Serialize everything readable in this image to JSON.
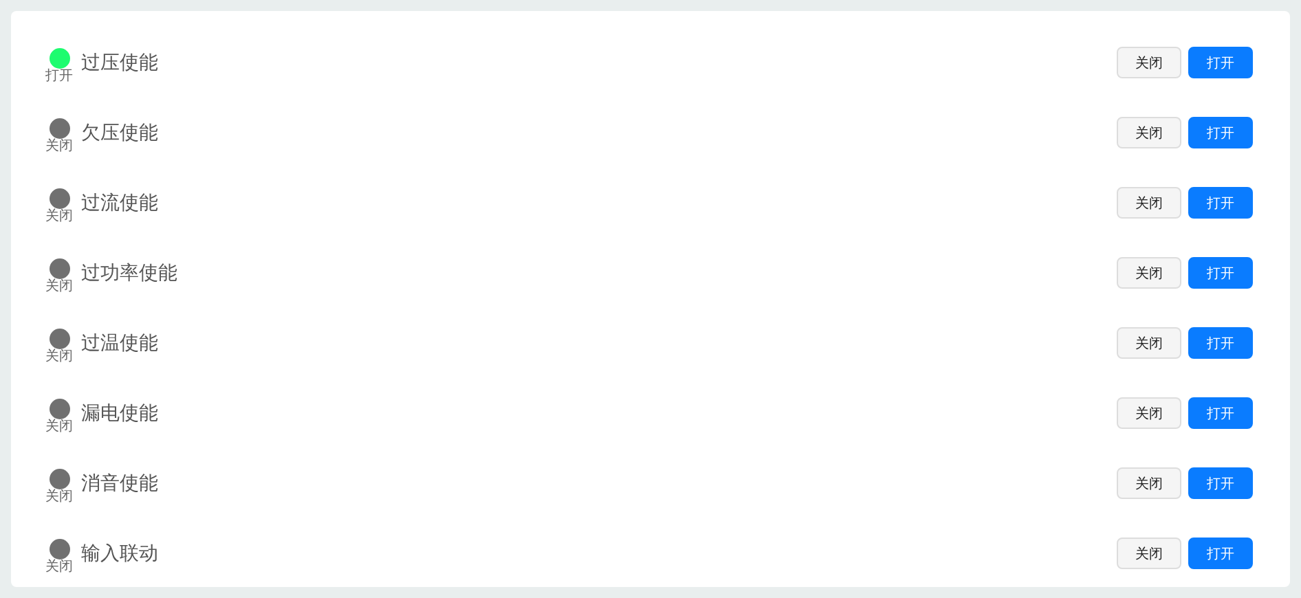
{
  "switches": [
    {
      "name": "过压使能",
      "on": true,
      "status": "打开",
      "buttons": [
        "关闭",
        "打开"
      ]
    },
    {
      "name": "欠压使能",
      "on": false,
      "status": "关闭",
      "buttons": [
        "关闭",
        "打开"
      ]
    },
    {
      "name": "过流使能",
      "on": false,
      "status": "关闭",
      "buttons": [
        "关闭",
        "打开"
      ]
    },
    {
      "name": "过功率使能",
      "on": false,
      "status": "关闭",
      "buttons": [
        "关闭",
        "打开"
      ]
    },
    {
      "name": "过温使能",
      "on": false,
      "status": "关闭",
      "buttons": [
        "关闭",
        "打开"
      ]
    },
    {
      "name": "漏电使能",
      "on": false,
      "status": "关闭",
      "buttons": [
        "关闭",
        "打开"
      ]
    },
    {
      "name": "消音使能",
      "on": false,
      "status": "关闭",
      "buttons": [
        "关闭",
        "打开"
      ]
    },
    {
      "name": "输入联动",
      "on": false,
      "status": "关闭",
      "buttons": [
        "关闭",
        "打开"
      ]
    }
  ]
}
